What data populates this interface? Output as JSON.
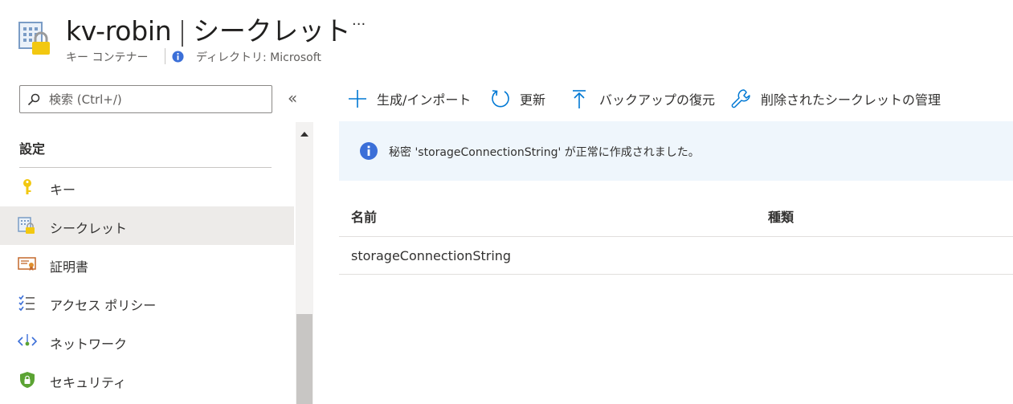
{
  "header": {
    "resource_name": "kv-robin",
    "separator": "|",
    "page_name": "シークレット",
    "more": "···",
    "resource_type": "キー コンテナー",
    "directory": "ディレクトリ: Microsoft"
  },
  "search": {
    "placeholder": "検索 (Ctrl+/)",
    "value": ""
  },
  "sidebar": {
    "collapse": "«",
    "section": "設定",
    "items": [
      {
        "label": "キー",
        "icon": "key-icon",
        "active": false
      },
      {
        "label": "シークレット",
        "icon": "secret-icon",
        "active": true
      },
      {
        "label": "証明書",
        "icon": "certificate-icon",
        "active": false
      },
      {
        "label": "アクセス ポリシー",
        "icon": "access-policy-icon",
        "active": false
      },
      {
        "label": "ネットワーク",
        "icon": "network-icon",
        "active": false
      },
      {
        "label": "セキュリティ",
        "icon": "security-shield-icon",
        "active": false
      }
    ]
  },
  "toolbar": {
    "generate_import": "生成/インポート",
    "refresh": "更新",
    "restore_backup": "バックアップの復元",
    "manage_deleted": "削除されたシークレットの管理"
  },
  "banner": {
    "message": "秘密 'storageConnectionString' が正常に作成されました。"
  },
  "table": {
    "columns": [
      "名前",
      "種類"
    ],
    "rows": [
      {
        "name": "storageConnectionString",
        "type": ""
      }
    ]
  },
  "colors": {
    "accent": "#0078d4",
    "key": "#f2c811",
    "active_bg": "#edebe9",
    "banner_bg": "#eff6fc",
    "info": "#3b6fd8"
  }
}
